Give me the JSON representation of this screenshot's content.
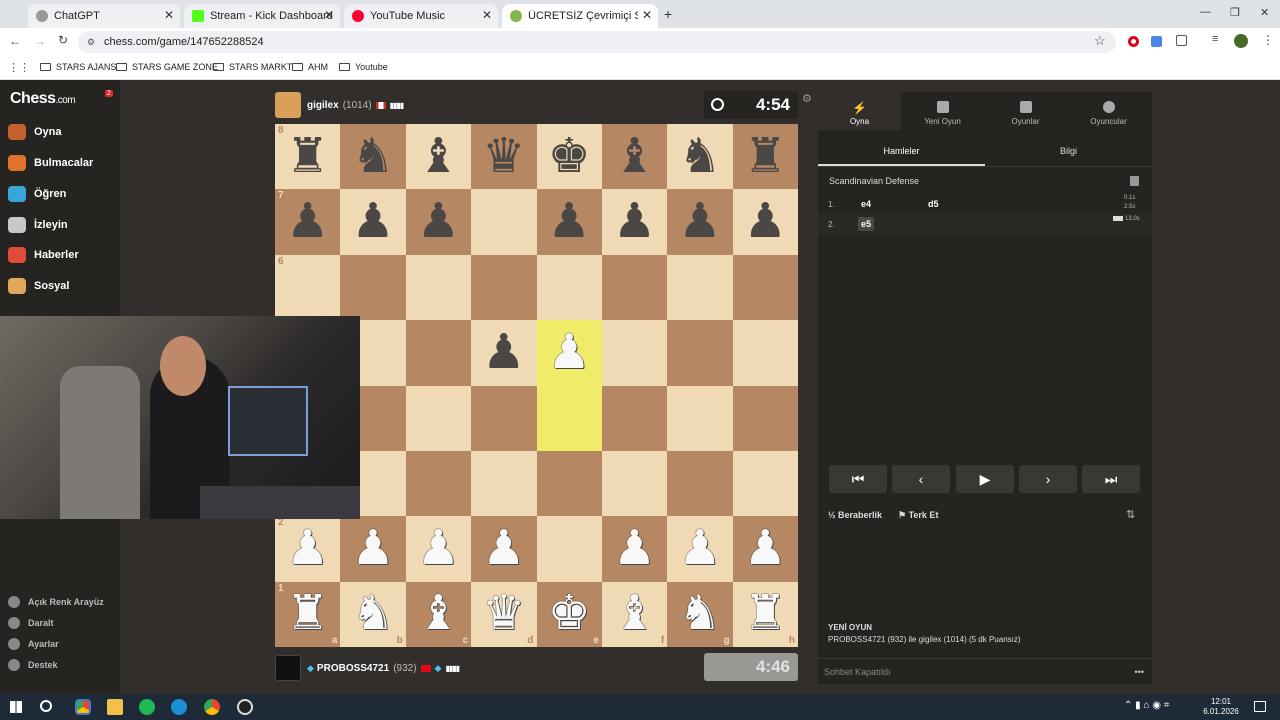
{
  "browser": {
    "tabs": [
      {
        "label": "ChatGPT",
        "color": "#888"
      },
      {
        "label": "Stream - Kick Dashboard",
        "color": "#53fc18"
      },
      {
        "label": "YouTube Music",
        "color": "#ff0033"
      },
      {
        "label": "ÜCRETSİZ Çevrimiçi Satranç",
        "color": "#81b64c"
      }
    ],
    "url": "chess.com/game/147652288524",
    "bookmarks": [
      "STARS AJANS",
      "STARS GAME ZONE",
      "STARS MARKT",
      "AHM",
      "Youtube"
    ]
  },
  "sidebar": {
    "logo": "Chess",
    "logo_suffix": ".com",
    "notification_count": "2",
    "items": [
      {
        "label": "Oyna",
        "icon": "play-icon",
        "color": "#c4622d"
      },
      {
        "label": "Bulmacalar",
        "icon": "puzzle-icon",
        "color": "#e0732d"
      },
      {
        "label": "Öğren",
        "icon": "learn-icon",
        "color": "#3aa5d9"
      },
      {
        "label": "İzleyin",
        "icon": "binoculars-icon",
        "color": "#c8c8c8"
      },
      {
        "label": "Haberler",
        "icon": "news-icon",
        "color": "#e04b3a"
      },
      {
        "label": "Sosyal",
        "icon": "social-icon",
        "color": "#e0a85a"
      }
    ],
    "footer": [
      {
        "label": "Açık Renk Arayüz",
        "icon": "theme-icon"
      },
      {
        "label": "Daralt",
        "icon": "collapse-icon"
      },
      {
        "label": "Ayarlar",
        "icon": "settings-icon"
      },
      {
        "label": "Destek",
        "icon": "help-icon"
      }
    ]
  },
  "top_player": {
    "name": "gigilex",
    "rating": "(1014)",
    "clock": "4:54"
  },
  "bottom_player": {
    "name": "PROBOSS4721",
    "rating": "(932)",
    "clock": "4:46"
  },
  "board": {
    "rows": [
      [
        "br",
        "bn",
        "bb",
        "bq",
        "bk",
        "bb",
        "bn",
        "br"
      ],
      [
        "bp",
        "bp",
        "bp",
        "",
        "bp",
        "bp",
        "bp",
        "bp"
      ],
      [
        "",
        "",
        "",
        "",
        "",
        "",
        "",
        ""
      ],
      [
        "",
        "",
        "",
        "bp",
        "wp",
        "",
        "",
        ""
      ],
      [
        "",
        "",
        "",
        "",
        "",
        "",
        "",
        ""
      ],
      [
        "",
        "",
        "",
        "",
        "",
        "",
        "",
        ""
      ],
      [
        "wp",
        "wp",
        "wp",
        "wp",
        "",
        "wp",
        "wp",
        "wp"
      ],
      [
        "wr",
        "wn",
        "wb",
        "wq",
        "wk",
        "wb",
        "wn",
        "wr"
      ]
    ],
    "highlights": [
      [
        3,
        4
      ],
      [
        4,
        4
      ]
    ],
    "ranks": [
      "8",
      "7",
      "6",
      "",
      "",
      "",
      "2",
      "1"
    ],
    "files": [
      "a",
      "b",
      "c",
      "d",
      "e",
      "f",
      "g",
      "h"
    ]
  },
  "panel": {
    "tabs": [
      {
        "label": "Oyna",
        "icon": "bolt-icon"
      },
      {
        "label": "Yeni Oyun",
        "icon": "plus-icon"
      },
      {
        "label": "Oyunlar",
        "icon": "board-icon"
      },
      {
        "label": "Oyuncular",
        "icon": "players-icon"
      }
    ],
    "subtabs": [
      "Hamleler",
      "Bilgi"
    ],
    "opening": "Scandinavian Defense",
    "moves": [
      {
        "num": "1.",
        "white": "e4",
        "black": "d5",
        "t1": "0.1s",
        "t2": "2.5s"
      },
      {
        "num": "2.",
        "white": "e5",
        "black": "",
        "t1": "13.0s",
        "t2": ""
      }
    ],
    "actions": {
      "draw": "Beraberlik",
      "resign": "Terk Et"
    },
    "new_game_title": "YENİ OYUN",
    "new_game_text": "PROBOSS4721 (932) ile gigilex (1014) (5 dk Puansız)",
    "chat": "Sohbet Kapatıldı"
  },
  "taskbar": {
    "time": "12:01",
    "date": "6.01.2026"
  }
}
